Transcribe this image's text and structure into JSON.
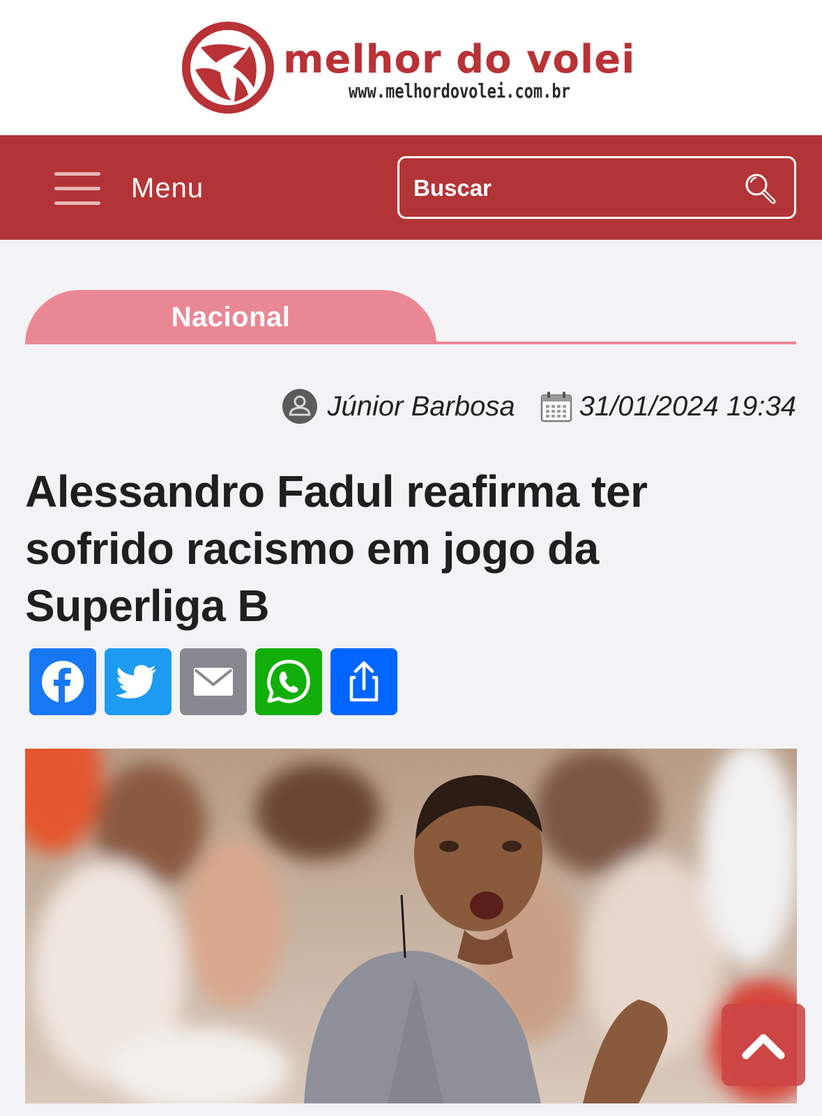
{
  "site": {
    "logo_title": "melhor do volei",
    "logo_url": "www.melhordovolei.com.br",
    "brand_color": "#b33437"
  },
  "nav": {
    "menu_label": "Menu",
    "menu_icon": "hamburger-icon",
    "search_placeholder": "Buscar",
    "search_icon": "magnifier-icon"
  },
  "article": {
    "category": "Nacional",
    "category_color": "#ea8795",
    "author": "Júnior Barbosa",
    "author_icon": "user-icon",
    "datetime": "31/01/2024 19:34",
    "datetime_icon": "calendar-icon",
    "headline": "Alessandro Fadul reafirma ter sofrido racismo em jogo da Superliga B",
    "share": [
      {
        "name": "Facebook",
        "icon": "facebook-icon",
        "color": "#1877f2"
      },
      {
        "name": "Twitter",
        "icon": "twitter-icon",
        "color": "#1d9bf0"
      },
      {
        "name": "Email",
        "icon": "email-icon",
        "color": "#888990"
      },
      {
        "name": "WhatsApp",
        "icon": "whatsapp-icon",
        "color": "#12af0a"
      },
      {
        "name": "Share",
        "icon": "share-icon",
        "color": "#0166ff"
      }
    ]
  },
  "scroll_top_icon": "chevron-up-icon"
}
